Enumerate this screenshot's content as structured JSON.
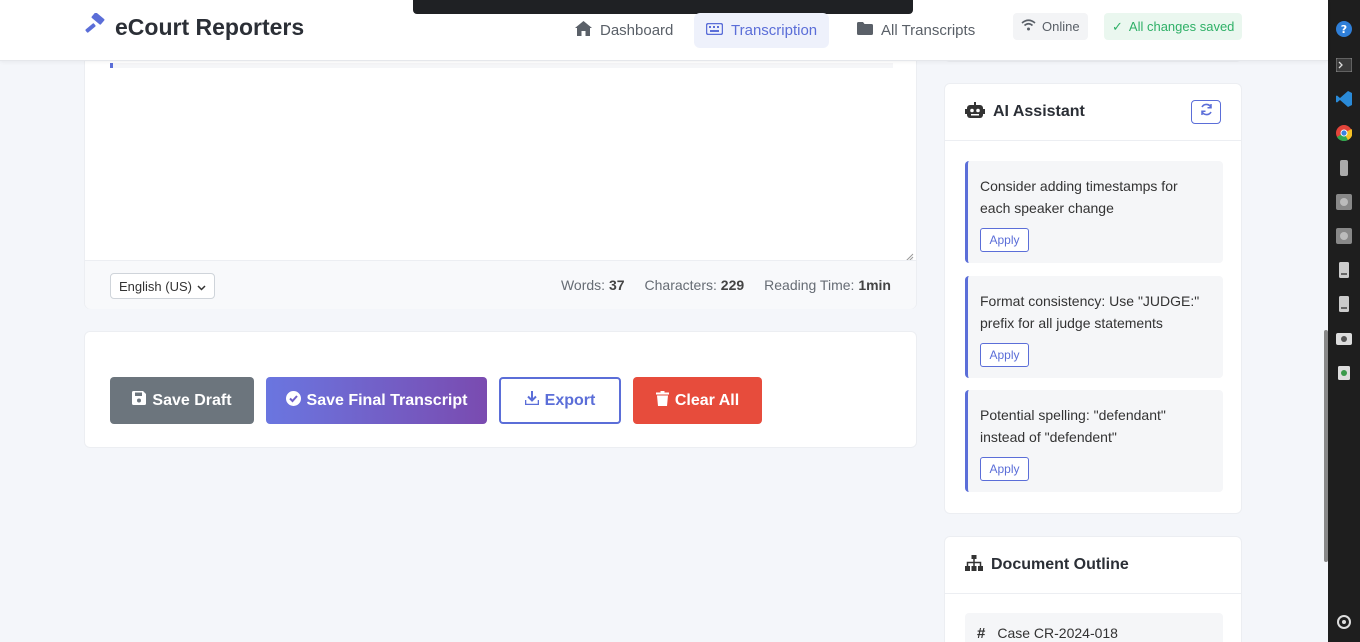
{
  "brand": {
    "name": "eCourt Reporters",
    "icon": "gavel-icon"
  },
  "nav": {
    "links": [
      {
        "label": "Dashboard",
        "icon": "home-icon"
      },
      {
        "label": "Transcription",
        "icon": "keyboard-icon",
        "active": true
      },
      {
        "label": "All Transcripts",
        "icon": "folder-icon"
      }
    ],
    "status_online": "Online",
    "status_saved": "All changes saved"
  },
  "editor": {
    "language": "English (US)",
    "stats": {
      "words_label": "Words:",
      "words": "37",
      "chars_label": "Characters:",
      "chars": "229",
      "reading_label": "Reading Time:",
      "reading": "1min"
    }
  },
  "actions": {
    "save_draft": "Save Draft",
    "save_final": "Save Final Transcript",
    "export": "Export",
    "clear_all": "Clear All"
  },
  "ai_assistant": {
    "title": "AI Assistant",
    "suggestions": [
      {
        "text": "Consider adding timestamps for each speaker change",
        "apply": "Apply"
      },
      {
        "text": "Format consistency: Use \"JUDGE:\" prefix for all judge statements",
        "apply": "Apply"
      },
      {
        "text": "Potential spelling: \"defendant\" instead of \"defendent\"",
        "apply": "Apply"
      }
    ]
  },
  "outline": {
    "title": "Document Outline",
    "items": [
      {
        "marker": "#",
        "label": "Case CR-2024-018"
      }
    ]
  },
  "colors": {
    "accent": "#5b6ed8",
    "danger": "#e74c3c",
    "secondary": "#6c757d",
    "success": "#2fb067"
  }
}
